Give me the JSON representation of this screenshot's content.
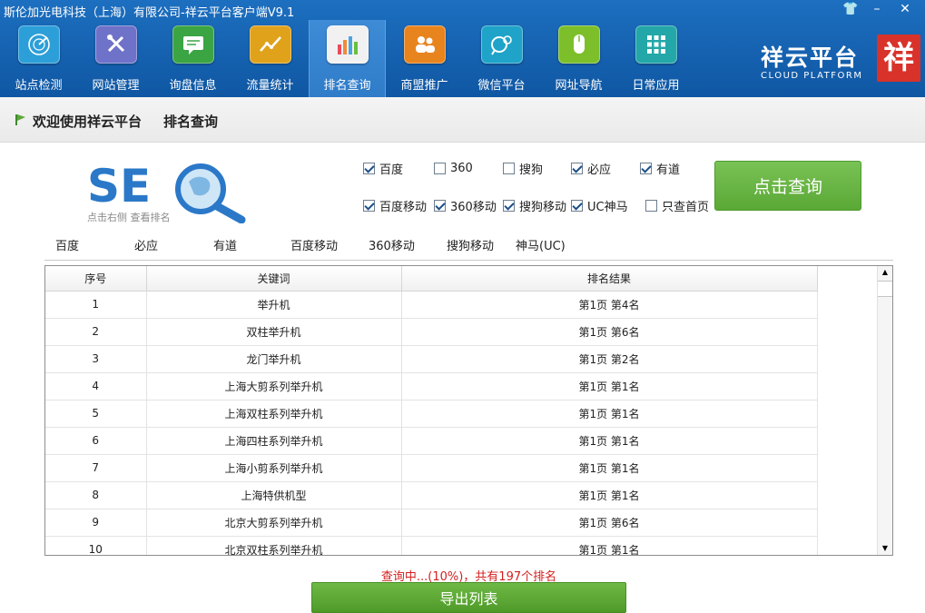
{
  "window": {
    "title": "斯伦加光电科技（上海）有限公司-祥云平台客户端V9.1",
    "controls": {
      "skin": "👕",
      "minimize": "–",
      "close": "✕"
    }
  },
  "nav": {
    "items": [
      {
        "label": "站点检测",
        "icon": "radar-icon",
        "color": "#2d9fd8",
        "active": false
      },
      {
        "label": "网站管理",
        "icon": "tools-icon",
        "color": "#6f72c9",
        "active": false
      },
      {
        "label": "询盘信息",
        "icon": "message-icon",
        "color": "#3aa542",
        "active": false
      },
      {
        "label": "流量统计",
        "icon": "trend-chart-icon",
        "color": "#e0a21b",
        "active": false
      },
      {
        "label": "排名查询",
        "icon": "bar-chart-icon",
        "color": "#f1f1f1",
        "active": true
      },
      {
        "label": "商盟推广",
        "icon": "users-icon",
        "color": "#e8841e",
        "active": false
      },
      {
        "label": "微信平台",
        "icon": "wechat-icon",
        "color": "#1fa3c9",
        "active": false
      },
      {
        "label": "网址导航",
        "icon": "mouse-icon",
        "color": "#7cbf2a",
        "active": false
      },
      {
        "label": "日常应用",
        "icon": "grid-icon",
        "color": "#23a7a8",
        "active": false
      }
    ]
  },
  "brand": {
    "name": "祥云平台",
    "english": "CLOUD PLATFORM",
    "seal": "祥"
  },
  "welcome": {
    "greeting": "欢迎使用祥云平台",
    "page": "排名查询"
  },
  "seo": {
    "hint": "点击右侧 查看排名"
  },
  "engines": {
    "row1": [
      {
        "label": "百度",
        "checked": true
      },
      {
        "label": "360",
        "checked": false
      },
      {
        "label": "搜狗",
        "checked": false
      },
      {
        "label": "必应",
        "checked": true
      },
      {
        "label": "有道",
        "checked": true
      }
    ],
    "row2": [
      {
        "label": "百度移动",
        "checked": true
      },
      {
        "label": "360移动",
        "checked": true
      },
      {
        "label": "搜狗移动",
        "checked": true
      },
      {
        "label": "UC神马",
        "checked": true
      },
      {
        "label": "只查首页",
        "checked": false
      }
    ],
    "query_button": "点击查询"
  },
  "tabs": [
    "百度",
    "必应",
    "有道",
    "百度移动",
    "360移动",
    "搜狗移动",
    "神马(UC)"
  ],
  "active_tab": 0,
  "table": {
    "headers": [
      "序号",
      "关键词",
      "排名结果"
    ],
    "rows": [
      [
        "1",
        "举升机",
        "第1页 第4名"
      ],
      [
        "2",
        "双柱举升机",
        "第1页 第6名"
      ],
      [
        "3",
        "龙门举升机",
        "第1页 第2名"
      ],
      [
        "4",
        "上海大剪系列举升机",
        "第1页 第1名"
      ],
      [
        "5",
        "上海双柱系列举升机",
        "第1页 第1名"
      ],
      [
        "6",
        "上海四柱系列举升机",
        "第1页 第1名"
      ],
      [
        "7",
        "上海小剪系列举升机",
        "第1页 第1名"
      ],
      [
        "8",
        "上海特供机型",
        "第1页 第1名"
      ],
      [
        "9",
        "北京大剪系列举升机",
        "第1页 第6名"
      ],
      [
        "10",
        "北京双柱系列举升机",
        "第1页 第1名"
      ]
    ]
  },
  "status": "查询中...(10%)，共有197个排名",
  "export_button": "导出列表"
}
